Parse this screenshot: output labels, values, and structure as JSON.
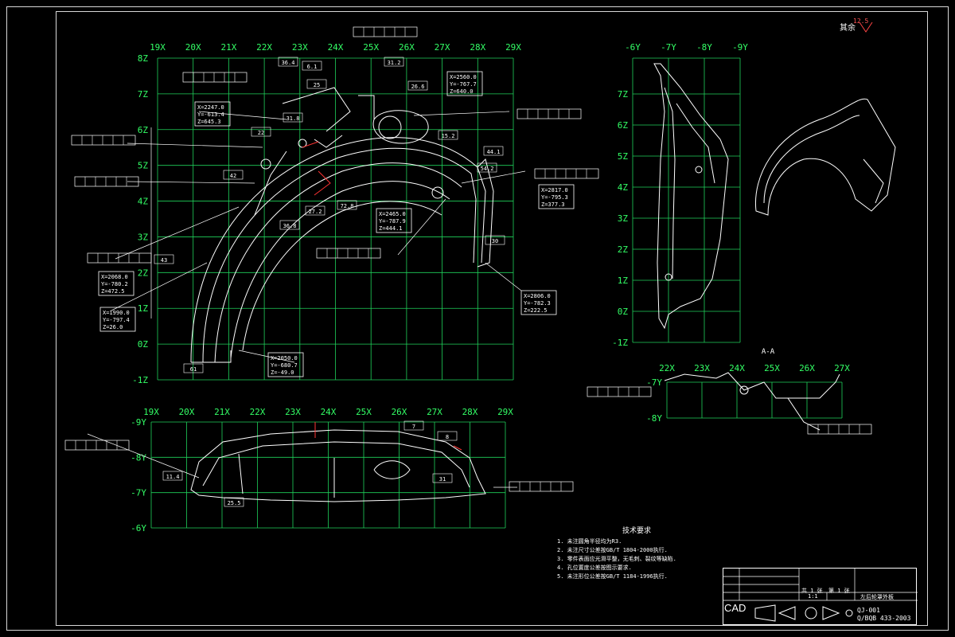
{
  "grid_front": {
    "x_labels": [
      "19X",
      "20X",
      "21X",
      "22X",
      "23X",
      "24X",
      "25X",
      "26X",
      "27X",
      "28X",
      "29X"
    ],
    "z_labels": [
      "8Z",
      "7Z",
      "6Z",
      "5Z",
      "4Z",
      "3Z",
      "2Z",
      "1Z",
      "0Z",
      "-1Z"
    ]
  },
  "grid_side": {
    "y_labels": [
      "-6Y",
      "-7Y",
      "-8Y",
      "-9Y"
    ],
    "z_labels": [
      "7Z",
      "6Z",
      "5Z",
      "4Z",
      "3Z",
      "2Z",
      "1Z",
      "0Z",
      "-1Z"
    ]
  },
  "grid_top": {
    "x_labels": [
      "19X",
      "20X",
      "21X",
      "22X",
      "23X",
      "24X",
      "25X",
      "26X",
      "27X",
      "28X",
      "29X"
    ],
    "y_labels": [
      "-9Y",
      "-8Y",
      "-7Y",
      "-6Y"
    ]
  },
  "grid_section": {
    "x_labels": [
      "22X",
      "23X",
      "24X",
      "25X",
      "26X",
      "27X"
    ],
    "y_labels": [
      "-7Y",
      "-8Y"
    ],
    "section_label": "A-A"
  },
  "roughness": {
    "label": "其余",
    "value": "12.5"
  },
  "coordinate_boxes": [
    {
      "id": "c1",
      "lines": [
        "X=2247.0",
        "Y=-613.4",
        "Z=645.3"
      ]
    },
    {
      "id": "c2",
      "lines": [
        "X=2560.0",
        "Y=-767.7",
        "Z=640.0"
      ]
    },
    {
      "id": "c3",
      "lines": [
        "X=2465.0",
        "Y=-787.9",
        "Z=444.1"
      ]
    },
    {
      "id": "c4",
      "lines": [
        "X=2068.0",
        "Y=-780.2",
        "Z=472.5"
      ]
    },
    {
      "id": "c5",
      "lines": [
        "X=1990.0",
        "Y=-797.4",
        "Z=26.0"
      ]
    },
    {
      "id": "c6",
      "lines": [
        "X=2050.0",
        "Y=-680.7",
        "Z=-49.0"
      ]
    },
    {
      "id": "c7",
      "lines": [
        "X=2806.0",
        "Y=-782.3",
        "Z=222.5"
      ]
    },
    {
      "id": "c8",
      "lines": [
        "X=2817.0",
        "Y=-795.3",
        "Z=377.3"
      ]
    }
  ],
  "dimensions": [
    "36.4",
    "6.1",
    "25",
    "31.2",
    "26.6",
    "31.8",
    "15.2",
    "54.2",
    "44.1",
    "27.2",
    "36.8",
    "72.8",
    "42",
    "22",
    "43",
    "30",
    "61",
    "11.4",
    "25.5",
    "31",
    "8",
    "7"
  ],
  "technical_requirements": {
    "title": "技术要求",
    "items": [
      "1. 未注圆角半径均为R3.",
      "2. 未注尺寸公差按GB/T 1804-2000执行.",
      "3. 零件表面应光滑平整，无毛刺、裂纹等缺陷.",
      "4. 孔位置度公差按图示要求.",
      "5. 未注形位公差按GB/T 1184-1996执行."
    ]
  },
  "title_block": {
    "part_name": "左后轮罩外板",
    "scale": "1:1",
    "sheet_total": "共 1 张",
    "sheet_no": "第 1 张",
    "drawing_no": "Q/BQB 433-2003",
    "doc_code": "QJ-001",
    "cad_brand": "CAD"
  }
}
